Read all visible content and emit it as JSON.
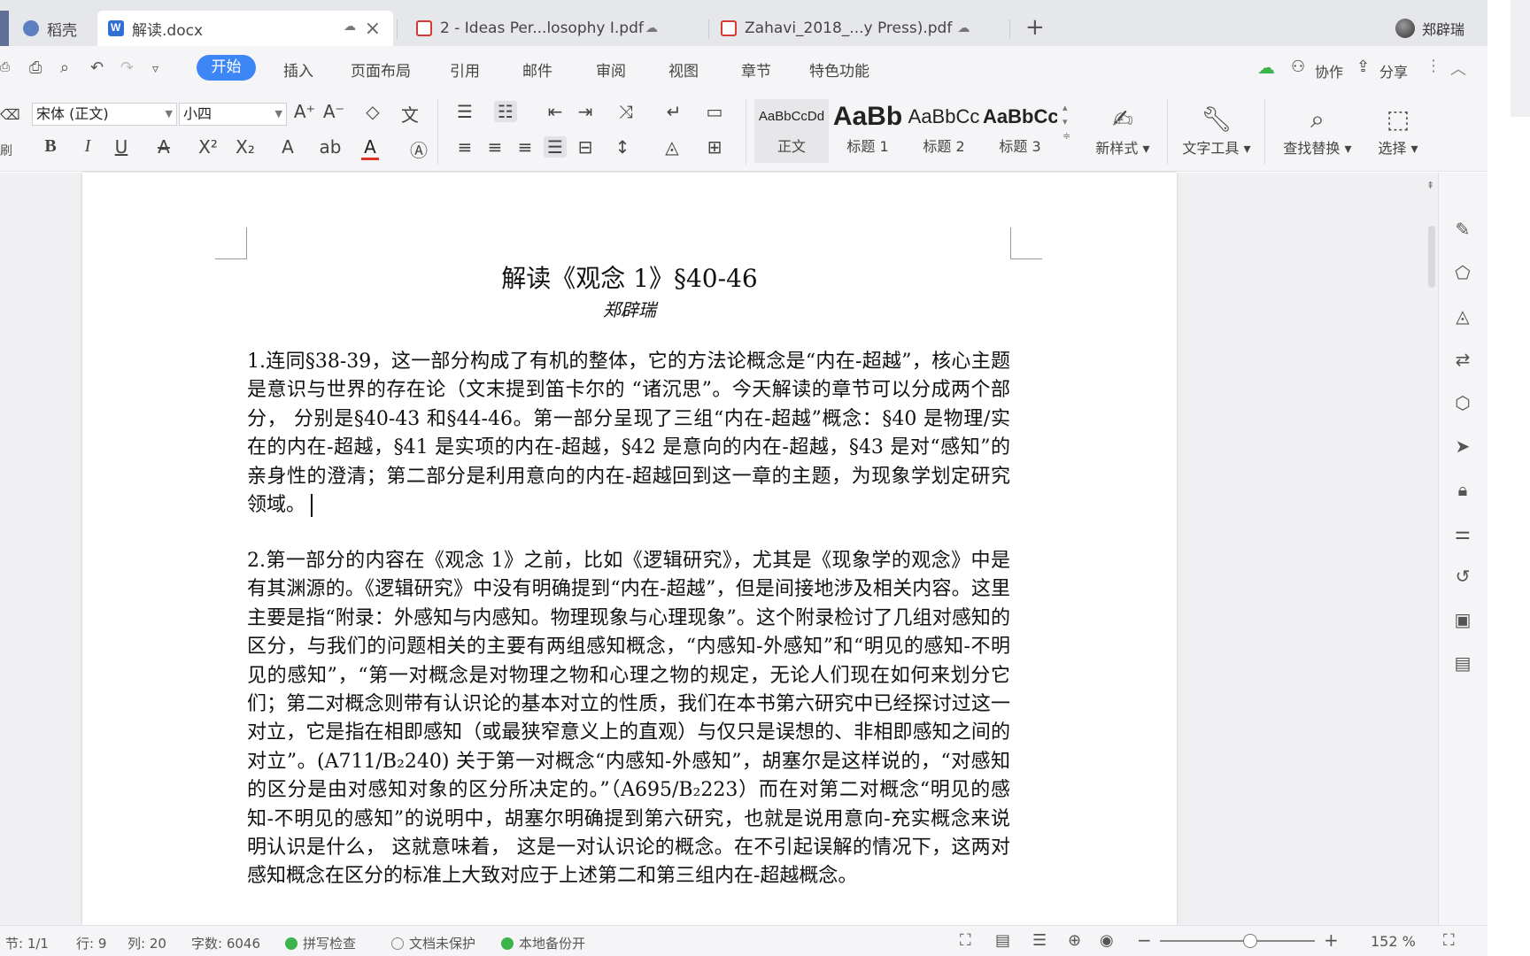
{
  "tabs": [
    {
      "label": "稻壳",
      "icon": "daoke-icon"
    },
    {
      "label": "解读.docx",
      "icon": "word-doc-icon",
      "active": true
    },
    {
      "label": "2 - Ideas Per...losophy I.pdf",
      "icon": "pdf-icon"
    },
    {
      "label": "Zahavi_2018_...y Press).pdf",
      "icon": "pdf-icon"
    }
  ],
  "user": {
    "name": "郑辟瑞"
  },
  "menu": {
    "items": [
      "开始",
      "插入",
      "页面布局",
      "引用",
      "邮件",
      "审阅",
      "视图",
      "章节",
      "特色功能"
    ],
    "right": {
      "collab": "协作",
      "share": "分享"
    }
  },
  "ribbon": {
    "font_name": "宋体 (正文)",
    "font_size": "小四",
    "left_cut_label": "刷",
    "styles": [
      {
        "sample": "AaBbCcDd",
        "name": "正文"
      },
      {
        "sample": "AaBb",
        "name": "标题 1"
      },
      {
        "sample": "AaBbCc",
        "name": "标题 2"
      },
      {
        "sample": "AaBbCc",
        "name": "标题 3"
      }
    ],
    "new_style": "新样式",
    "text_tools": "文字工具",
    "find_replace": "查找替换",
    "select": "选择"
  },
  "document": {
    "title": "解读《观念 1》§40-46",
    "author": "郑辟瑞",
    "para1": "1.连同§38-39，这一部分构成了有机的整体，它的方法论概念是“内在-超越”，核心主题是意识与世界的存在论（文末提到笛卡尔的 “诸沉思”。今天解读的章节可以分成两个部分， 分别是§40-43 和§44-46。第一部分呈现了三组“内在-超越”概念：§40 是物理/实在的内在-超越，§41 是实项的内在-超越，§42 是意向的内在-超越，§43 是对“感知”的亲身性的澄清；第二部分是利用意向的内在-超越回到这一章的主题，为现象学划定研究领域。",
    "para2": "2.第一部分的内容在《观念 1》之前，比如《逻辑研究》，尤其是《现象学的观念》中是有其渊源的。《逻辑研究》中没有明确提到“内在-超越”，但是间接地涉及相关内容。这里主要是指“附录：外感知与内感知。物理现象与心理现象”。这个附录检讨了几组对感知的区分，与我们的问题相关的主要有两组感知概念，“内感知-外感知”和“明见的感知-不明见的感知”，“第一对概念是对物理之物和心理之物的规定，无论人们现在如何来划分它们；第二对概念则带有认识论的基本对立的性质，我们在本书第六研究中已经探讨过这一对立，它是指在相即感知（或最狭窄意义上的直观）与仅只是误想的、非相即感知之间的对立”。(A711/B₂240) 关于第一对概念“内感知-外感知”，胡塞尔是这样说的，“对感知的区分是由对感知对象的区分所决定的。”（A695/B₂223）而在对第二对概念“明见的感知-不明见的感知”的说明中，胡塞尔明确提到第六研究，也就是说用意向-充实概念来说明认识是什么， 这就意味着， 这是一对认识论的概念。在不引起误解的情况下，这两对感知概念在区分的标准上大致对应于上述第二和第三组内在-超越概念。"
  },
  "status": {
    "section": "节: 1/1",
    "row": "行: 9",
    "col": "列: 20",
    "word_count": "字数: 6046",
    "spell_check": "拼写检查",
    "doc_protect": "文档未保护",
    "backup": "本地备份开",
    "zoom": "152 %",
    "zoom_fraction": 0.58
  }
}
